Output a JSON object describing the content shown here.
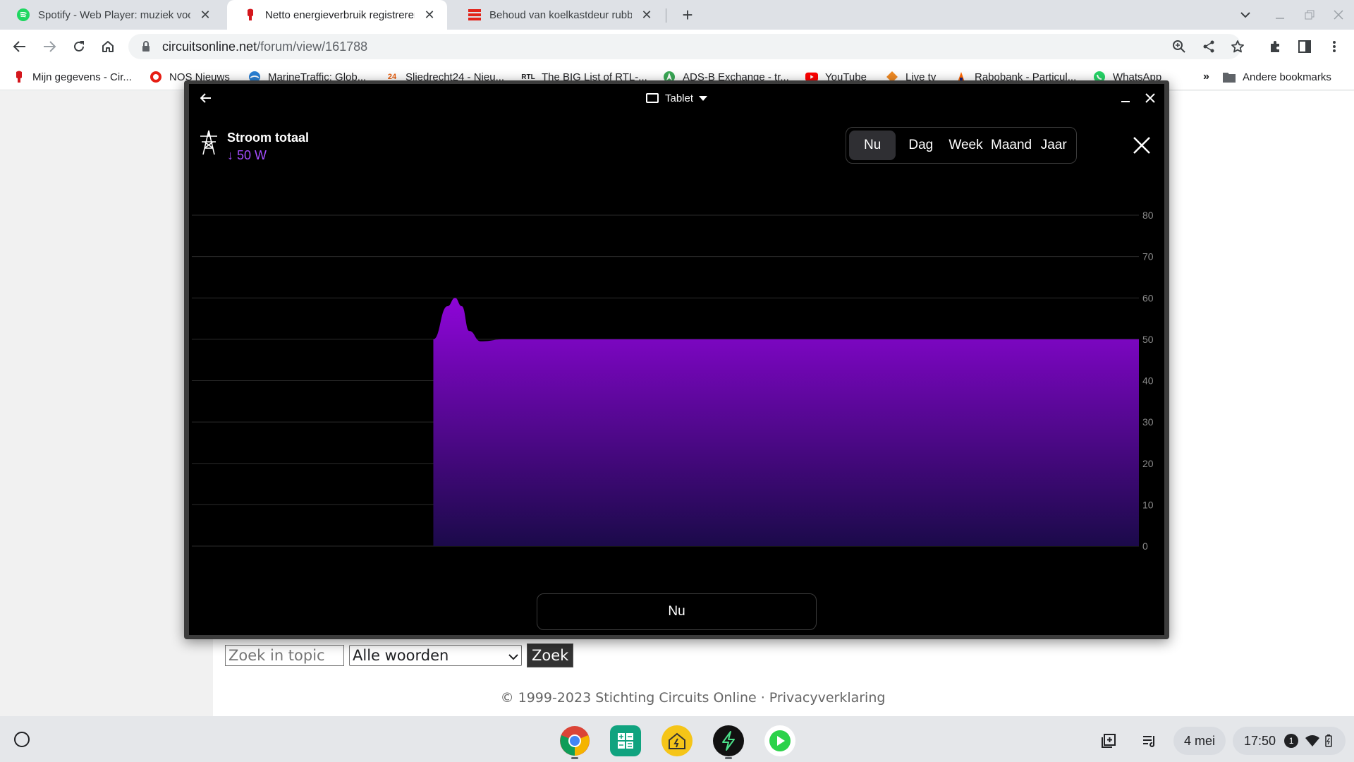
{
  "tabs": [
    {
      "title": "Spotify - Web Player: muziek voor iedereen",
      "favicon": "spotify-icon"
    },
    {
      "title": "Netto energieverbruik registreren",
      "favicon": "circuitsonline-icon",
      "active": true
    },
    {
      "title": "Behoud van koelkastdeur rubbers",
      "favicon": "news-icon"
    }
  ],
  "omnibox": {
    "domain": "circuitsonline.net",
    "path": "/forum/view/161788"
  },
  "bookmarks": [
    {
      "label": "Mijn gegevens - Cir...",
      "icon": "circuitsonline-icon"
    },
    {
      "label": "NOS Nieuws",
      "icon": "nos-icon"
    },
    {
      "label": "MarineTraffic: Glob...",
      "icon": "marinetraffic-icon"
    },
    {
      "label": "Sliedrecht24 - Nieu...",
      "icon": "sliedrecht24-icon"
    },
    {
      "label": "The BIG List of RTL-...",
      "icon": "rtl-icon"
    },
    {
      "label": "ADS-B Exchange - tr...",
      "icon": "adsb-icon"
    },
    {
      "label": "YouTube",
      "icon": "youtube-icon"
    },
    {
      "label": "Live tv",
      "icon": "livetv-icon"
    },
    {
      "label": "Rabobank - Particul...",
      "icon": "rabobank-icon"
    },
    {
      "label": "WhatsApp",
      "icon": "whatsapp-icon"
    }
  ],
  "bookmarks_more": "»",
  "other_bookmarks": "Andere bookmarks",
  "page": {
    "search_placeholder": "Zoek in topic",
    "search_mode": "Alle woorden",
    "search_button": "Zoek",
    "copyright": "© 1999-2023 Stichting Circuits Online",
    "footer_sep": "·",
    "privacy": "Privacyverklaring"
  },
  "app": {
    "mode_label": "Tablet",
    "meter_title": "Stroom totaal",
    "meter_value": "↓ 50 W",
    "periods": [
      "Nu",
      "Dag",
      "Week",
      "Maand",
      "Jaar"
    ],
    "active_period": "Nu",
    "bottom_label": "Nu"
  },
  "colors": {
    "accent": "#a44dff",
    "area_top": "#8e05d8",
    "area_bottom": "#1b0a4a",
    "app_bg": "#000000"
  },
  "chart_data": {
    "type": "area",
    "xlabel": "",
    "ylabel": "",
    "ylim": [
      0,
      80
    ],
    "yticks": [
      0,
      10,
      20,
      30,
      40,
      50,
      60,
      70,
      80
    ],
    "grid": true,
    "series": [
      {
        "x": [
          0.255,
          0.27,
          0.278,
          0.285,
          0.293,
          0.305,
          0.33,
          0.5,
          1.0
        ],
        "values": [
          50,
          58,
          60,
          58,
          52,
          49.5,
          50,
          50,
          50
        ]
      }
    ],
    "x_start_fraction": 0.255
  },
  "shelf": {
    "apps": [
      "chrome-icon",
      "calculator-icon",
      "home-energy-icon",
      "energy-app-icon",
      "media-player-icon"
    ],
    "date": "4 mei",
    "time": "17:50",
    "notification_count": "1"
  }
}
